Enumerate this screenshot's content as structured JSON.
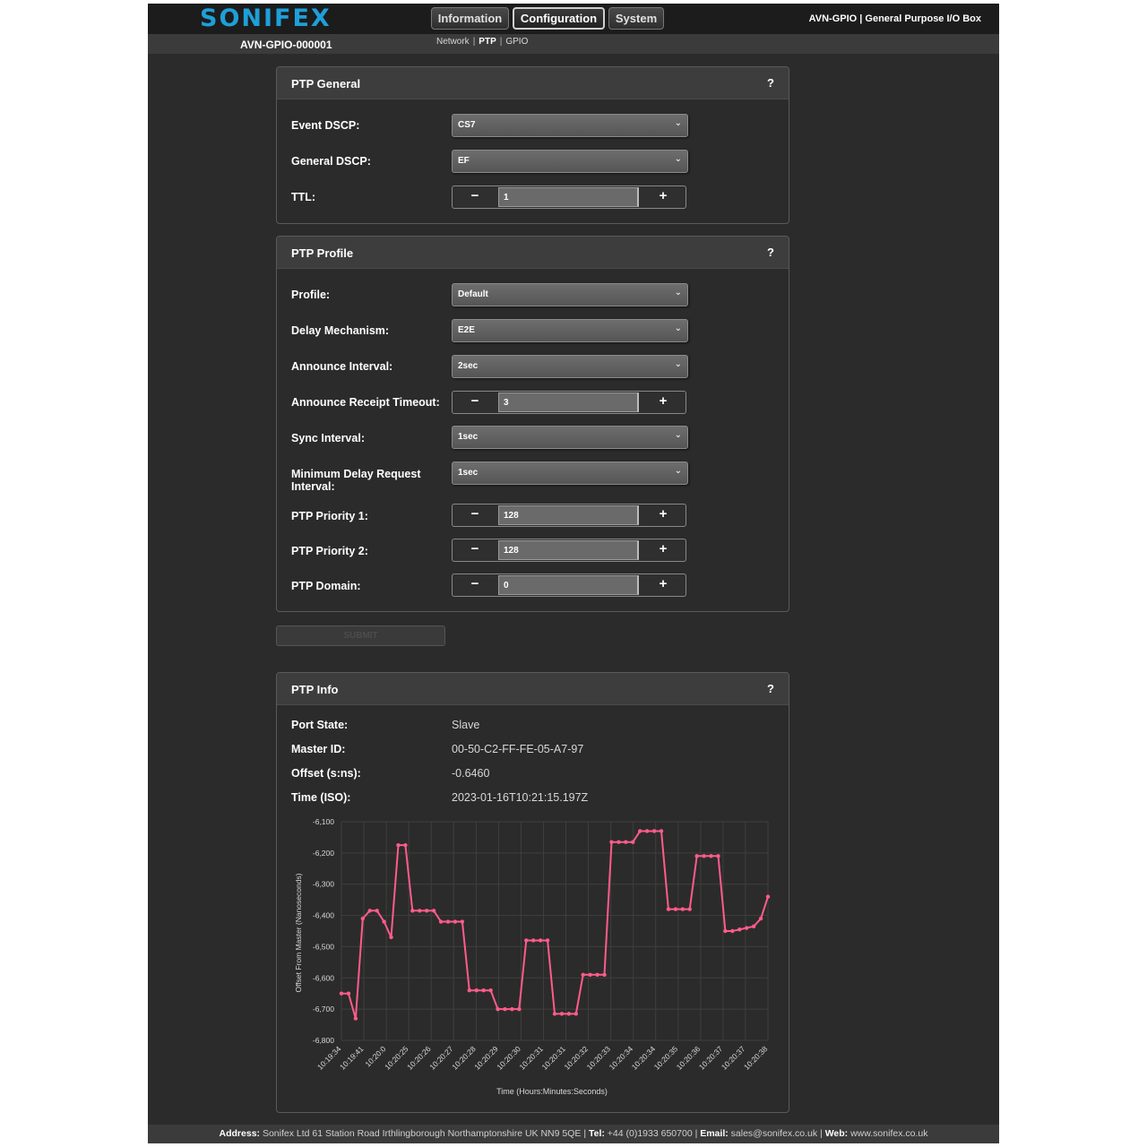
{
  "header": {
    "logo": "SONIFEX",
    "tabs": [
      {
        "label": "Information",
        "active": false
      },
      {
        "label": "Configuration",
        "active": true
      },
      {
        "label": "System",
        "active": false
      }
    ],
    "product_title": "AVN-GPIO | General Purpose I/O Box",
    "device_id": "AVN-GPIO-000001",
    "subnav": [
      "Network",
      "PTP",
      "GPIO"
    ],
    "subnav_current": "PTP"
  },
  "ptp_general": {
    "title": "PTP General",
    "help": "?",
    "event_dscp": {
      "label": "Event DSCP:",
      "value": "CS7"
    },
    "general_dscp": {
      "label": "General DSCP:",
      "value": "EF"
    },
    "ttl": {
      "label": "TTL:",
      "value": "1"
    }
  },
  "ptp_profile": {
    "title": "PTP Profile",
    "help": "?",
    "profile": {
      "label": "Profile:",
      "value": "Default"
    },
    "delay_mechanism": {
      "label": "Delay Mechanism:",
      "value": "E2E"
    },
    "announce_interval": {
      "label": "Announce Interval:",
      "value": "2sec"
    },
    "announce_receipt_timeout": {
      "label": "Announce Receipt Timeout:",
      "value": "3"
    },
    "sync_interval": {
      "label": "Sync Interval:",
      "value": "1sec"
    },
    "min_delay_request": {
      "label": "Minimum Delay Request Interval:",
      "value": "1sec"
    },
    "priority1": {
      "label": "PTP Priority 1:",
      "value": "128"
    },
    "priority2": {
      "label": "PTP Priority 2:",
      "value": "128"
    },
    "domain": {
      "label": "PTP Domain:",
      "value": "0"
    }
  },
  "stepper": {
    "minus": "−",
    "plus": "+"
  },
  "select_chevron": "⌄",
  "submit_label": "SUBMIT",
  "ptp_info": {
    "title": "PTP Info",
    "help": "?",
    "port_state": {
      "label": "Port State:",
      "value": "Slave"
    },
    "master_id": {
      "label": "Master ID:",
      "value": "00-50-C2-FF-FE-05-A7-97"
    },
    "offset": {
      "label": "Offset (s:ns):",
      "value": "-0.6460"
    },
    "time_iso": {
      "label": "Time (ISO):",
      "value": "2023-01-16T10:21:15.197Z"
    }
  },
  "chart_data": {
    "type": "line",
    "xlabel": "Time (Hours:Minutes:Seconds)",
    "ylabel": "Offset From Master (Nanoseconds)",
    "ylim": [
      -6800,
      -6100
    ],
    "yticks": [
      -6100,
      -6200,
      -6300,
      -6400,
      -6500,
      -6600,
      -6700,
      -6800
    ],
    "ytick_labels": [
      "-6,100",
      "-6,200",
      "-6,300",
      "-6,400",
      "-6,500",
      "-6,600",
      "-6,700",
      "-6,800"
    ],
    "xtick_labels": [
      "10:19:34",
      "10:19:41",
      "10:20:0",
      "10:20:25",
      "10:20:26",
      "10:20:27",
      "10:20:28",
      "10:20:29",
      "10:20:30",
      "10:20:31",
      "10:20:31",
      "10:20:32",
      "10:20:33",
      "10:20:34",
      "10:20:34",
      "10:20:35",
      "10:20:36",
      "10:20:37",
      "10:20:37",
      "10:20:38"
    ],
    "grid": true,
    "line_color": "#ff5c8a",
    "series": [
      {
        "values": [
          -6650,
          -6650,
          -6730,
          -6410,
          -6385,
          -6385,
          -6420,
          -6470,
          -6175,
          -6175,
          -6385,
          -6385,
          -6385,
          -6385,
          -6420,
          -6420,
          -6420,
          -6420,
          -6640,
          -6640,
          -6640,
          -6640,
          -6700,
          -6700,
          -6700,
          -6700,
          -6480,
          -6480,
          -6480,
          -6480,
          -6715,
          -6715,
          -6715,
          -6715,
          -6590,
          -6590,
          -6590,
          -6590,
          -6165,
          -6165,
          -6165,
          -6165,
          -6130,
          -6130,
          -6130,
          -6130,
          -6380,
          -6380,
          -6380,
          -6380,
          -6210,
          -6210,
          -6210,
          -6210,
          -6450,
          -6450,
          -6445,
          -6440,
          -6435,
          -6410,
          -6340
        ]
      }
    ]
  },
  "footer": {
    "address_label": "Address:",
    "address": "Sonifex Ltd 61 Station Road Irthlingborough Northamptonshire UK NN9 5QE",
    "tel_label": "Tel:",
    "tel": "+44 (0)1933 650700",
    "email_label": "Email:",
    "email": "sales@sonifex.co.uk",
    "web_label": "Web:",
    "web": "www.sonifex.co.uk"
  }
}
